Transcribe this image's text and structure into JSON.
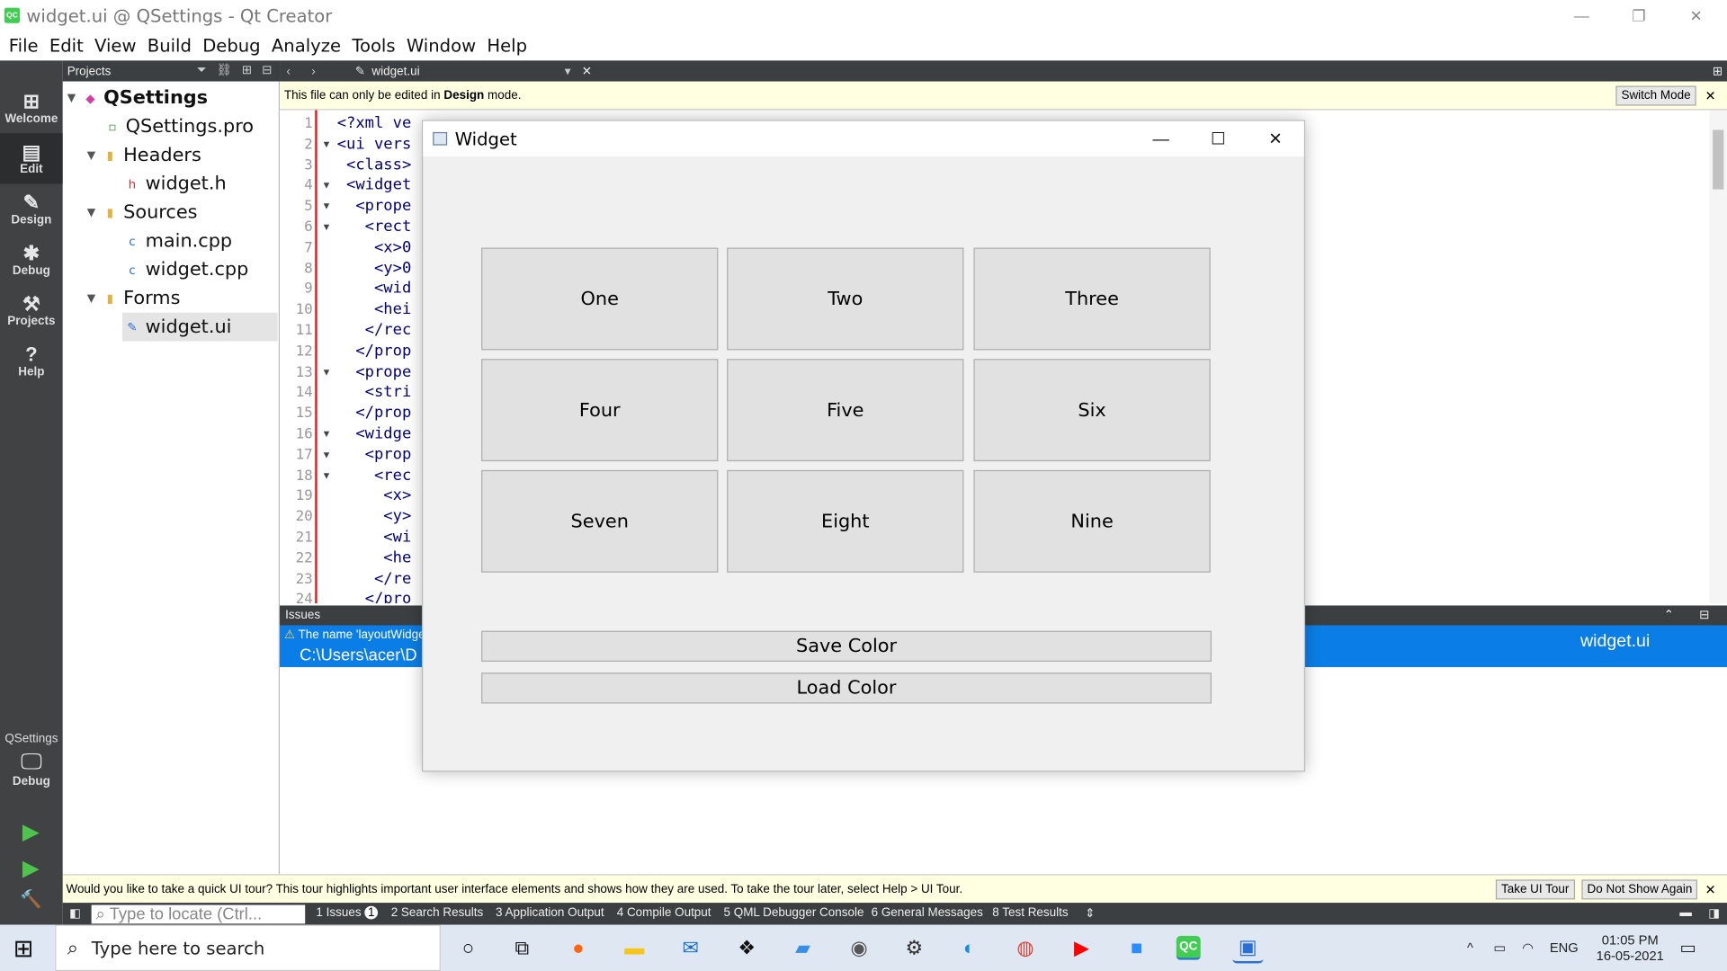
{
  "window": {
    "title": "widget.ui @ QSettings - Qt Creator",
    "app_icon_text": "QC",
    "minimize": "—",
    "restore": "❐",
    "close": "✕"
  },
  "menu": [
    "File",
    "Edit",
    "View",
    "Build",
    "Debug",
    "Analyze",
    "Tools",
    "Window",
    "Help"
  ],
  "modes": [
    {
      "label": "Welcome",
      "icon": "grid-icon",
      "glyph": "⊞"
    },
    {
      "label": "Edit",
      "icon": "edit-icon",
      "glyph": "▤"
    },
    {
      "label": "Design",
      "icon": "pencil-icon",
      "glyph": "✎"
    },
    {
      "label": "Debug",
      "icon": "bug-icon",
      "glyph": "✱"
    },
    {
      "label": "Projects",
      "icon": "wrench-icon",
      "glyph": "⚒"
    },
    {
      "label": "Help",
      "icon": "help-icon",
      "glyph": "?"
    }
  ],
  "kit": {
    "project": "QSettings",
    "mode": "Debug",
    "glyph": "🖵"
  },
  "run_glyphs": {
    "run": "▶",
    "debug_run": "▶",
    "build": "🔨"
  },
  "projects_pane": {
    "header": "Projects",
    "tools": "⏷ ⛓ ⊞ ⊟",
    "tree": [
      {
        "label": "QSettings",
        "bold": true,
        "level": 0,
        "arrow": "▼",
        "icon": "project-icon",
        "glyph": "◆"
      },
      {
        "label": "QSettings.pro",
        "level": 1,
        "arrow": "",
        "icon": "pro-file-icon",
        "glyph": "▫"
      },
      {
        "label": "Headers",
        "level": 1,
        "arrow": "▼",
        "icon": "folder-icon",
        "glyph": "▮"
      },
      {
        "label": "widget.h",
        "level": 2,
        "arrow": "",
        "icon": "header-file-icon",
        "glyph": "h"
      },
      {
        "label": "Sources",
        "level": 1,
        "arrow": "▼",
        "icon": "folder-icon",
        "glyph": "▮"
      },
      {
        "label": "main.cpp",
        "level": 2,
        "arrow": "",
        "icon": "cpp-file-icon",
        "glyph": "c"
      },
      {
        "label": "widget.cpp",
        "level": 2,
        "arrow": "",
        "icon": "cpp-file-icon",
        "glyph": "c"
      },
      {
        "label": "Forms",
        "level": 1,
        "arrow": "▼",
        "icon": "folder-icon",
        "glyph": "▮"
      },
      {
        "label": "widget.ui",
        "level": 2,
        "arrow": "",
        "icon": "ui-file-icon",
        "glyph": "✎",
        "selected": true
      }
    ]
  },
  "editor": {
    "tab": "widget.ui",
    "nav": "‹ ›",
    "info_prefix": "This file can only be edited in ",
    "info_bold": "Design",
    "info_suffix": " mode.",
    "switch_mode": "Switch Mode",
    "close_glyph": "✕",
    "split_glyph": "⊞",
    "line_numbers": [
      "1",
      "2",
      "3",
      "4",
      "5",
      "6",
      "7",
      "8",
      "9",
      "10",
      "11",
      "12",
      "13",
      "14",
      "15",
      "16",
      "17",
      "18",
      "19",
      "20",
      "21",
      "22",
      "23",
      "24"
    ],
    "code_lines": [
      "<?xml ve",
      "<ui vers",
      " <class>",
      " <widget",
      "  <prope",
      "   <rect",
      "    <x>0",
      "    <y>0",
      "    <wid",
      "    <hei",
      "   </rec",
      "  </prop",
      "  <prope",
      "   <stri",
      "  </prop",
      "  <widge",
      "   <prop",
      "    <rec",
      "     <x>",
      "     <y>",
      "     <wi",
      "     <he",
      "    </re",
      "   </pro"
    ]
  },
  "issues": {
    "header": "Issues",
    "warning_glyph": "⚠",
    "message": "The name 'layoutWidge",
    "path": "C:\\Users\\acer\\D",
    "file": "widget.ui",
    "pane_controls": "⌃ ⊟"
  },
  "tour": {
    "text": "Would you like to take a quick UI tour? This tour highlights important user interface elements and shows how they are used. To take the tour later, select Help > UI Tour.",
    "take": "Take UI Tour",
    "dont": "Do Not Show Again",
    "close_glyph": "✕"
  },
  "output_bar": {
    "locate_placeholder": "Type to locate (Ctrl...",
    "tabs": [
      "1  Issues",
      "2  Search Results",
      "3  Application Output",
      "4  Compile Output",
      "5  QML Debugger Console",
      "6  General Messages",
      "8  Test Results"
    ],
    "issues_count": "1",
    "more": "⇕"
  },
  "widget": {
    "title": "Widget",
    "minimize": "—",
    "maximize": "☐",
    "close": "✕",
    "grid": [
      "One",
      "Two",
      "Three",
      "Four",
      "Five",
      "Six",
      "Seven",
      "Eight",
      "Nine"
    ],
    "save": "Save Color",
    "load": "Load Color"
  },
  "taskbar": {
    "start_glyph": "⊞",
    "search_glyph": "⌕",
    "search_placeholder": "Type here to search",
    "apps": [
      {
        "name": "cortana-icon",
        "glyph": "○",
        "color": "#111111"
      },
      {
        "name": "task-view-icon",
        "glyph": "⧉",
        "color": "#111111"
      },
      {
        "name": "firefox-icon",
        "glyph": "●",
        "color": "#ff6611"
      },
      {
        "name": "file-explorer-icon",
        "glyph": "▬",
        "color": "#f5c518"
      },
      {
        "name": "mail-icon",
        "glyph": "✉",
        "color": "#1570d6"
      },
      {
        "name": "dropbox-icon",
        "glyph": "❖",
        "color": "#111111"
      },
      {
        "name": "book-icon",
        "glyph": "▰",
        "color": "#3a8ee6"
      },
      {
        "name": "camera-icon",
        "glyph": "◉",
        "color": "#555555"
      },
      {
        "name": "settings-icon",
        "glyph": "⚙",
        "color": "#333333"
      },
      {
        "name": "edge-icon",
        "glyph": "◐",
        "color": "#1b8fd6"
      },
      {
        "name": "chrome-icon",
        "glyph": "◍",
        "color": "#db4437"
      },
      {
        "name": "youtube-icon",
        "glyph": "▶",
        "color": "#ff0000"
      },
      {
        "name": "zoom-icon",
        "glyph": "■",
        "color": "#2d8cff"
      },
      {
        "name": "qt-creator-icon",
        "glyph": "QC",
        "color": "#41cd52"
      },
      {
        "name": "widget-app-icon",
        "glyph": "▣",
        "color": "#2a6fd6"
      }
    ],
    "tray_up": "^",
    "battery_glyph": "▭",
    "wifi_glyph": "◠",
    "lang": "ENG",
    "time": "01:05 PM",
    "date": "16-05-2021",
    "notif_glyph": "▭"
  }
}
